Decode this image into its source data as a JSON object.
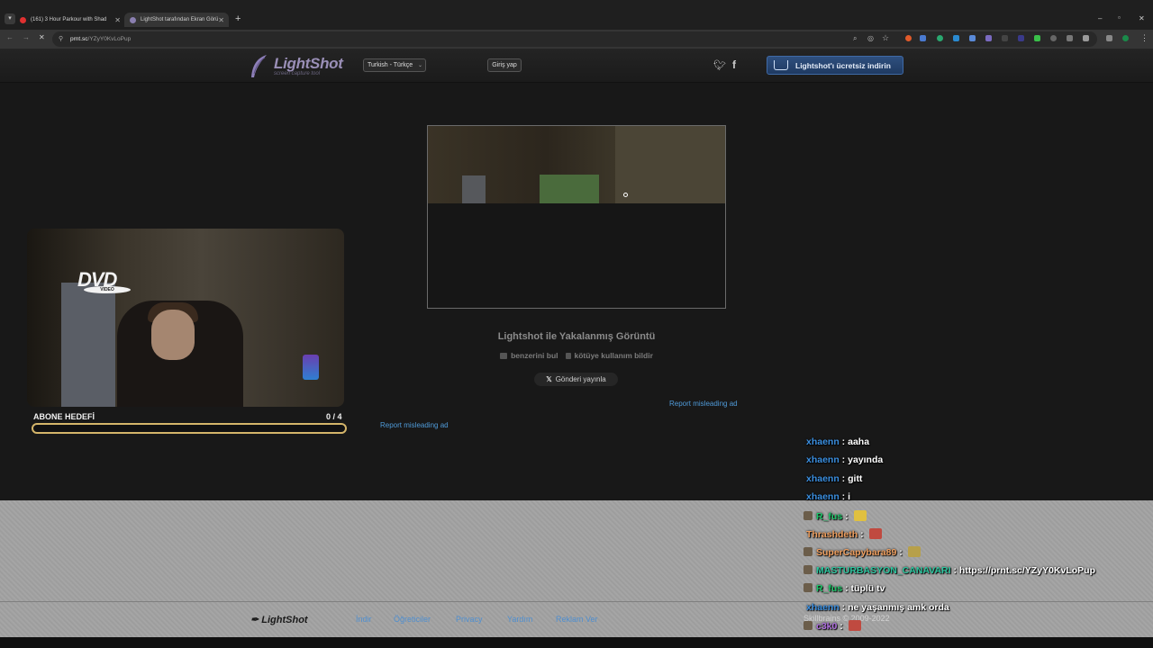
{
  "browser": {
    "tabs": [
      {
        "title": "(161) 3 Hour Parkour with Shad",
        "active": false
      },
      {
        "title": "LightShot tarafından Ekran Görü",
        "active": true
      }
    ],
    "new_tab": "+",
    "url_host": "prnt.sc",
    "url_path": "/YZyY0KvLoPup",
    "window_controls": [
      "–",
      "▫",
      "✕"
    ]
  },
  "header": {
    "logo_text": "LightShot",
    "logo_sub": "screen capture tool",
    "language": "Turkish - Türkçe",
    "login": "Giriş yap",
    "download": "Lightshot'ı ücretsiz indirin",
    "icons": [
      "twitter-icon",
      "facebook-icon",
      "download-cloud-icon"
    ]
  },
  "main": {
    "caption": "Lightshot ile Yakalanmış Görüntü",
    "find_similar": "benzerini bul",
    "report_abuse": "kötüye kullanım bildir",
    "post": "Gönderi yayınla",
    "report_ad_right": "Report misleading ad",
    "report_ad_left": "Report misleading ad"
  },
  "overlay": {
    "dvd": "DVD",
    "dvd_sub": "VIDEO",
    "goal_label": "ABONE HEDEFİ",
    "goal_count": "0  / 4",
    "goal_progress": 0
  },
  "footer": {
    "logo": "LightShot",
    "links": [
      "İndir",
      "Öğreticiler",
      "Privacy",
      "Yardım",
      "Reklam Ver"
    ],
    "copyright": "Skillbrains © 2009-2022"
  },
  "chat": [
    {
      "user": "xhaenn",
      "color": "#3b8fe0",
      "text": "aaha",
      "badge": false
    },
    {
      "user": "xhaenn",
      "color": "#3b8fe0",
      "text": "yayında",
      "badge": false
    },
    {
      "user": "xhaenn",
      "color": "#3b8fe0",
      "text": "gitt",
      "badge": false
    },
    {
      "user": "xhaenn",
      "color": "#3b8fe0",
      "text": "i",
      "badge": false
    },
    {
      "user": "R_fus",
      "color": "#1ec76a",
      "text": "",
      "badge": true,
      "emote": "#e0c040"
    },
    {
      "user": "Thrashdeth",
      "color": "#f0a060",
      "text": "",
      "badge": false,
      "emote": "#c04a40"
    },
    {
      "user": "SuperCapybara89",
      "color": "#f0a060",
      "text": "",
      "badge": true,
      "emote": "#b7a04a"
    },
    {
      "user": "MASTURBASYON_CANAVARI",
      "color": "#2ec7a0",
      "text": "https://prnt.sc/YZyY0KvLoPup",
      "badge": true
    },
    {
      "user": "R_fus",
      "color": "#1ec76a",
      "text": "tüplü tv",
      "badge": true
    },
    {
      "user": "xhaenn",
      "color": "#3b8fe0",
      "text": "ne yaşanmış amk orda",
      "badge": false
    },
    {
      "user": "c3k0",
      "color": "#b070e0",
      "text": "",
      "badge": true,
      "emote": "#c04a40"
    }
  ]
}
